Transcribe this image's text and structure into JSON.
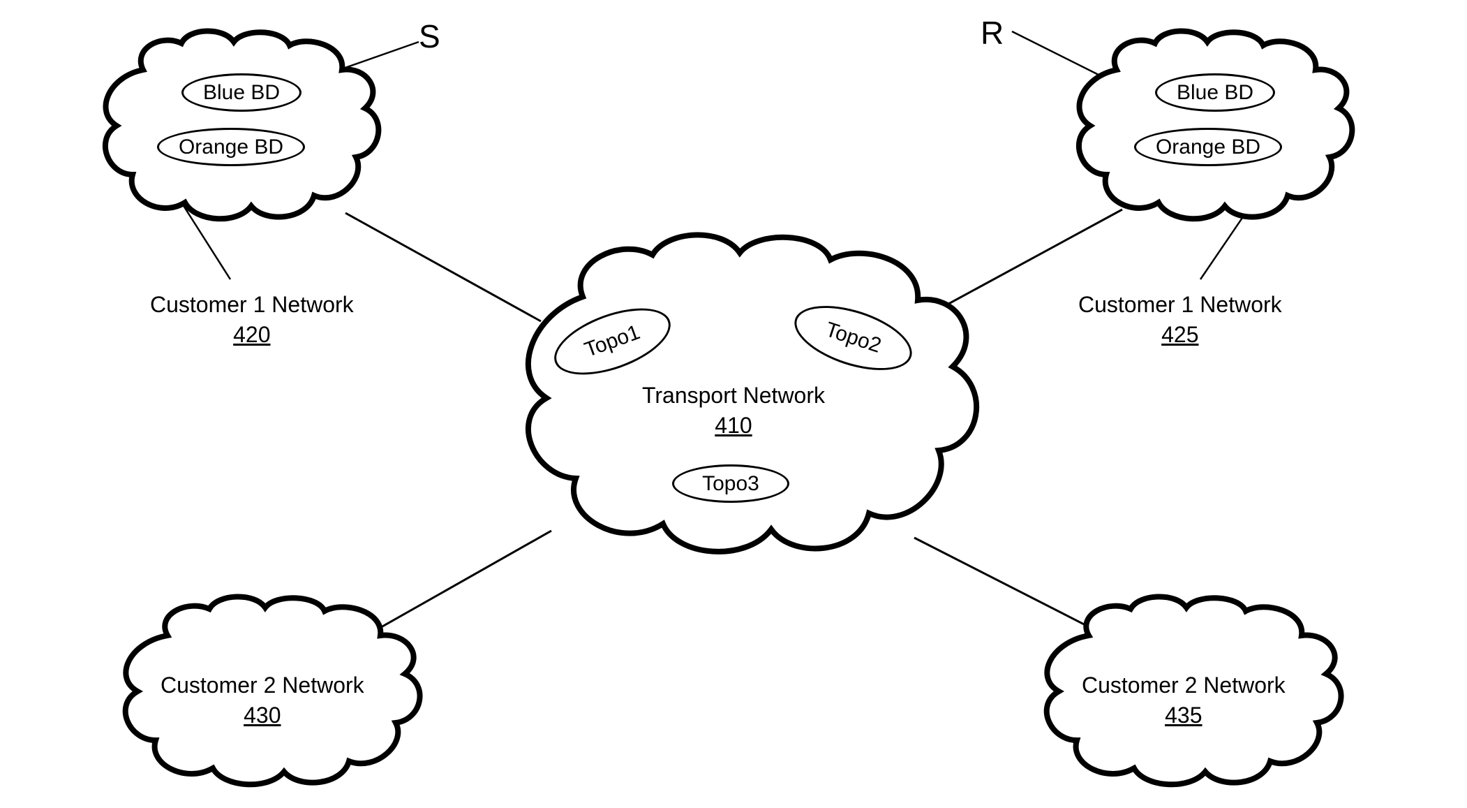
{
  "clouds": {
    "c1_left": {
      "title": "Customer 1 Network",
      "number": "420"
    },
    "c1_right": {
      "title": "Customer 1 Network",
      "number": "425"
    },
    "c2_left": {
      "title": "Customer 2 Network",
      "number": "430"
    },
    "c2_right": {
      "title": "Customer 2 Network",
      "number": "435"
    }
  },
  "transport": {
    "title": "Transport Network",
    "number": "410"
  },
  "ellipses": {
    "blue_bd_left": "Blue BD",
    "orange_bd_left": "Orange BD",
    "blue_bd_right": "Blue BD",
    "orange_bd_right": "Orange BD",
    "topo1": "Topo1",
    "topo2": "Topo2",
    "topo3": "Topo3"
  },
  "tags": {
    "s": "S",
    "r": "R"
  }
}
